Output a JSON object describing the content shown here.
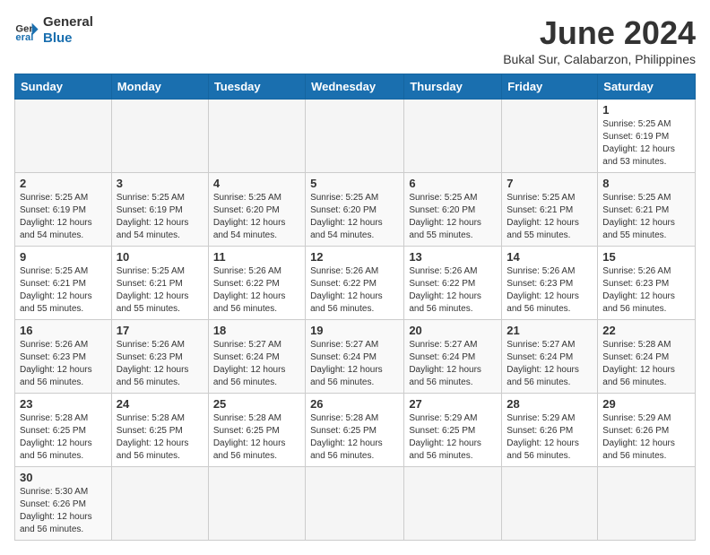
{
  "logo": {
    "line1": "General",
    "line2": "Blue"
  },
  "title": "June 2024",
  "subtitle": "Bukal Sur, Calabarzon, Philippines",
  "weekdays": [
    "Sunday",
    "Monday",
    "Tuesday",
    "Wednesday",
    "Thursday",
    "Friday",
    "Saturday"
  ],
  "weeks": [
    [
      {
        "day": "",
        "info": ""
      },
      {
        "day": "",
        "info": ""
      },
      {
        "day": "",
        "info": ""
      },
      {
        "day": "",
        "info": ""
      },
      {
        "day": "",
        "info": ""
      },
      {
        "day": "",
        "info": ""
      },
      {
        "day": "1",
        "info": "Sunrise: 5:25 AM\nSunset: 6:19 PM\nDaylight: 12 hours\nand 53 minutes."
      }
    ],
    [
      {
        "day": "2",
        "info": "Sunrise: 5:25 AM\nSunset: 6:19 PM\nDaylight: 12 hours\nand 54 minutes."
      },
      {
        "day": "3",
        "info": "Sunrise: 5:25 AM\nSunset: 6:19 PM\nDaylight: 12 hours\nand 54 minutes."
      },
      {
        "day": "4",
        "info": "Sunrise: 5:25 AM\nSunset: 6:20 PM\nDaylight: 12 hours\nand 54 minutes."
      },
      {
        "day": "5",
        "info": "Sunrise: 5:25 AM\nSunset: 6:20 PM\nDaylight: 12 hours\nand 54 minutes."
      },
      {
        "day": "6",
        "info": "Sunrise: 5:25 AM\nSunset: 6:20 PM\nDaylight: 12 hours\nand 55 minutes."
      },
      {
        "day": "7",
        "info": "Sunrise: 5:25 AM\nSunset: 6:21 PM\nDaylight: 12 hours\nand 55 minutes."
      },
      {
        "day": "8",
        "info": "Sunrise: 5:25 AM\nSunset: 6:21 PM\nDaylight: 12 hours\nand 55 minutes."
      }
    ],
    [
      {
        "day": "9",
        "info": "Sunrise: 5:25 AM\nSunset: 6:21 PM\nDaylight: 12 hours\nand 55 minutes."
      },
      {
        "day": "10",
        "info": "Sunrise: 5:25 AM\nSunset: 6:21 PM\nDaylight: 12 hours\nand 55 minutes."
      },
      {
        "day": "11",
        "info": "Sunrise: 5:26 AM\nSunset: 6:22 PM\nDaylight: 12 hours\nand 56 minutes."
      },
      {
        "day": "12",
        "info": "Sunrise: 5:26 AM\nSunset: 6:22 PM\nDaylight: 12 hours\nand 56 minutes."
      },
      {
        "day": "13",
        "info": "Sunrise: 5:26 AM\nSunset: 6:22 PM\nDaylight: 12 hours\nand 56 minutes."
      },
      {
        "day": "14",
        "info": "Sunrise: 5:26 AM\nSunset: 6:23 PM\nDaylight: 12 hours\nand 56 minutes."
      },
      {
        "day": "15",
        "info": "Sunrise: 5:26 AM\nSunset: 6:23 PM\nDaylight: 12 hours\nand 56 minutes."
      }
    ],
    [
      {
        "day": "16",
        "info": "Sunrise: 5:26 AM\nSunset: 6:23 PM\nDaylight: 12 hours\nand 56 minutes."
      },
      {
        "day": "17",
        "info": "Sunrise: 5:26 AM\nSunset: 6:23 PM\nDaylight: 12 hours\nand 56 minutes."
      },
      {
        "day": "18",
        "info": "Sunrise: 5:27 AM\nSunset: 6:24 PM\nDaylight: 12 hours\nand 56 minutes."
      },
      {
        "day": "19",
        "info": "Sunrise: 5:27 AM\nSunset: 6:24 PM\nDaylight: 12 hours\nand 56 minutes."
      },
      {
        "day": "20",
        "info": "Sunrise: 5:27 AM\nSunset: 6:24 PM\nDaylight: 12 hours\nand 56 minutes."
      },
      {
        "day": "21",
        "info": "Sunrise: 5:27 AM\nSunset: 6:24 PM\nDaylight: 12 hours\nand 56 minutes."
      },
      {
        "day": "22",
        "info": "Sunrise: 5:28 AM\nSunset: 6:24 PM\nDaylight: 12 hours\nand 56 minutes."
      }
    ],
    [
      {
        "day": "23",
        "info": "Sunrise: 5:28 AM\nSunset: 6:25 PM\nDaylight: 12 hours\nand 56 minutes."
      },
      {
        "day": "24",
        "info": "Sunrise: 5:28 AM\nSunset: 6:25 PM\nDaylight: 12 hours\nand 56 minutes."
      },
      {
        "day": "25",
        "info": "Sunrise: 5:28 AM\nSunset: 6:25 PM\nDaylight: 12 hours\nand 56 minutes."
      },
      {
        "day": "26",
        "info": "Sunrise: 5:28 AM\nSunset: 6:25 PM\nDaylight: 12 hours\nand 56 minutes."
      },
      {
        "day": "27",
        "info": "Sunrise: 5:29 AM\nSunset: 6:25 PM\nDaylight: 12 hours\nand 56 minutes."
      },
      {
        "day": "28",
        "info": "Sunrise: 5:29 AM\nSunset: 6:26 PM\nDaylight: 12 hours\nand 56 minutes."
      },
      {
        "day": "29",
        "info": "Sunrise: 5:29 AM\nSunset: 6:26 PM\nDaylight: 12 hours\nand 56 minutes."
      }
    ],
    [
      {
        "day": "30",
        "info": "Sunrise: 5:30 AM\nSunset: 6:26 PM\nDaylight: 12 hours\nand 56 minutes."
      },
      {
        "day": "",
        "info": ""
      },
      {
        "day": "",
        "info": ""
      },
      {
        "day": "",
        "info": ""
      },
      {
        "day": "",
        "info": ""
      },
      {
        "day": "",
        "info": ""
      },
      {
        "day": "",
        "info": ""
      }
    ]
  ]
}
